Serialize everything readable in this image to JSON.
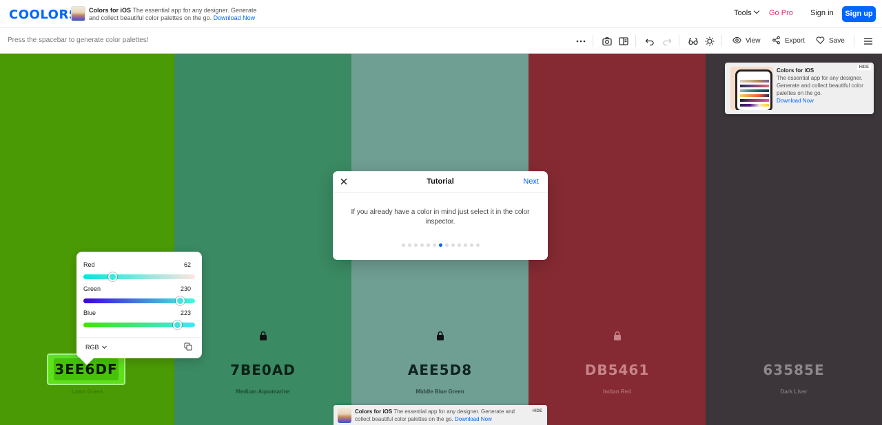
{
  "header": {
    "logo": "coolors",
    "ad": {
      "title": "Colors for iOS",
      "text": "The essential app for any designer. Generate and collect beautiful color palettes on the go.",
      "cta": "Download Now"
    },
    "nav": {
      "tools": "Tools",
      "go_pro": "Go Pro",
      "sign_in": "Sign in",
      "sign_up": "Sign up"
    }
  },
  "toolbar": {
    "hint": "Press the spacebar to generate color palettes!",
    "view": "View",
    "export": "Export",
    "save": "Save"
  },
  "palette": {
    "colors": [
      {
        "hex": "3EE6DF",
        "name": "Lawn Green",
        "bg": "#4a9a05",
        "fg": "#0b1a00",
        "name_fg": "#3b7a05",
        "locked": false
      },
      {
        "hex": "7BE0AD",
        "name": "Medium Aquamarine",
        "bg": "#3a8a63",
        "fg": "#0d1f16",
        "name_fg": "#1f4d37",
        "locked": true
      },
      {
        "hex": "AEE5D8",
        "name": "Middle Blue Green",
        "bg": "#6f9e93",
        "fg": "#102420",
        "name_fg": "#2f4a44",
        "locked": true
      },
      {
        "hex": "DB5461",
        "name": "Indian Red",
        "bg": "#852a32",
        "fg": "#c7848a",
        "name_fg": "#b06a71",
        "locked": true
      },
      {
        "hex": "63585E",
        "name": "Dark Liver",
        "bg": "#3c3539",
        "fg": "#8f878b",
        "name_fg": "#7d7579",
        "locked": false
      }
    ]
  },
  "inspector": {
    "channels": [
      {
        "label": "Red",
        "value": "62"
      },
      {
        "label": "Green",
        "value": "230"
      },
      {
        "label": "Blue",
        "value": "223"
      }
    ],
    "mode": "RGB"
  },
  "tutorial": {
    "title": "Tutorial",
    "next": "Next",
    "body": "If you already have a color in mind just select it in the color inspector.",
    "steps": 13,
    "active_step": 6
  },
  "side_ad": {
    "hide": "HIDE",
    "title": "Colors for iOS",
    "text": "The essential app for any designer. Generate and collect beautiful color palettes on the go.",
    "cta": "Download Now"
  },
  "bottom_ad": {
    "hide": "HIDE",
    "title": "Colors for iOS",
    "text": "The essential app for any designer. Generate and collect beautiful color palettes on the go.",
    "cta": "Download Now"
  },
  "colors": {
    "brand": "#0066ff",
    "go_pro": "#e1306c"
  }
}
